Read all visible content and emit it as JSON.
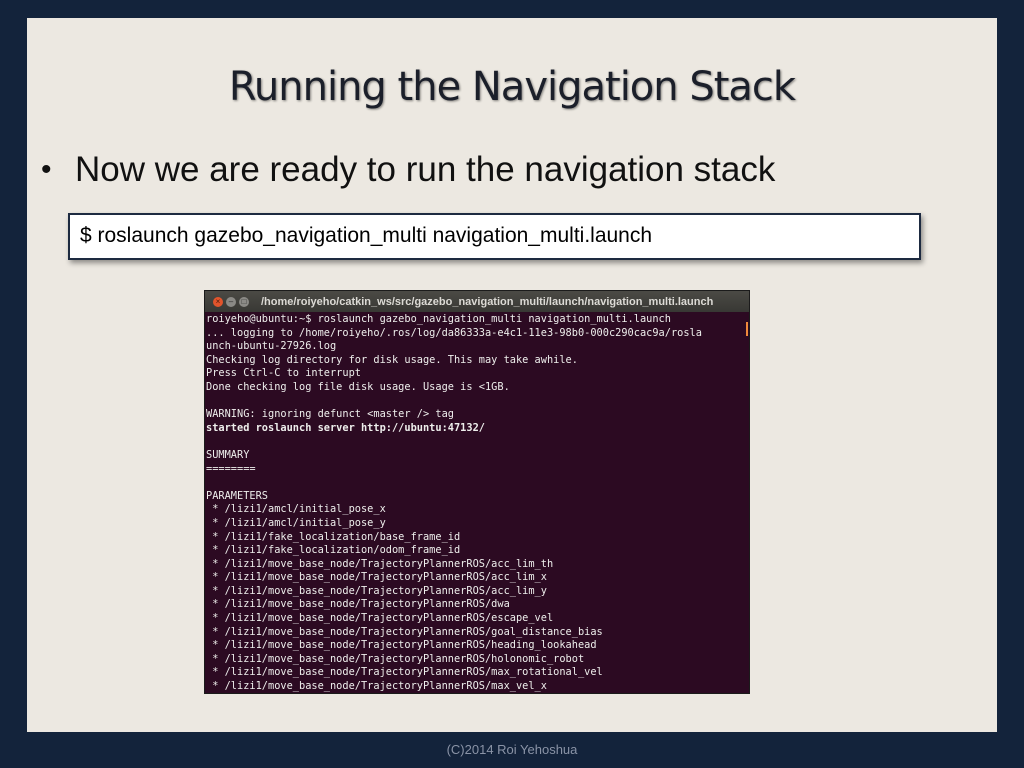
{
  "slide": {
    "title": "Running the Navigation Stack",
    "bullet": "Now we are ready to run the navigation stack",
    "command": "$ roslaunch gazebo_navigation_multi navigation_multi.launch",
    "footer": "(C)2014 Roi Yehoshua"
  },
  "terminal": {
    "title": "/home/roiyeho/catkin_ws/src/gazebo_navigation_multi/launch/navigation_multi.launch",
    "buttons": {
      "close_icon": "×",
      "minimize_icon": "–",
      "maximize_icon": "□"
    },
    "lines": [
      {
        "text": "roiyeho@ubuntu:~$ roslaunch gazebo_navigation_multi navigation_multi.launch",
        "bold": false
      },
      {
        "text": "... logging to /home/roiyeho/.ros/log/da86333a-e4c1-11e3-98b0-000c290cac9a/rosla",
        "bold": false
      },
      {
        "text": "unch-ubuntu-27926.log",
        "bold": false
      },
      {
        "text": "Checking log directory for disk usage. This may take awhile.",
        "bold": false
      },
      {
        "text": "Press Ctrl-C to interrupt",
        "bold": false
      },
      {
        "text": "Done checking log file disk usage. Usage is <1GB.",
        "bold": false
      },
      {
        "text": "",
        "bold": false
      },
      {
        "text": "WARNING: ignoring defunct <master /> tag",
        "bold": false
      },
      {
        "text": "started roslaunch server http://ubuntu:47132/",
        "bold": true
      },
      {
        "text": "",
        "bold": false
      },
      {
        "text": "SUMMARY",
        "bold": false
      },
      {
        "text": "========",
        "bold": false
      },
      {
        "text": "",
        "bold": false
      },
      {
        "text": "PARAMETERS",
        "bold": false
      },
      {
        "text": " * /lizi1/amcl/initial_pose_x",
        "bold": false
      },
      {
        "text": " * /lizi1/amcl/initial_pose_y",
        "bold": false
      },
      {
        "text": " * /lizi1/fake_localization/base_frame_id",
        "bold": false
      },
      {
        "text": " * /lizi1/fake_localization/odom_frame_id",
        "bold": false
      },
      {
        "text": " * /lizi1/move_base_node/TrajectoryPlannerROS/acc_lim_th",
        "bold": false
      },
      {
        "text": " * /lizi1/move_base_node/TrajectoryPlannerROS/acc_lim_x",
        "bold": false
      },
      {
        "text": " * /lizi1/move_base_node/TrajectoryPlannerROS/acc_lim_y",
        "bold": false
      },
      {
        "text": " * /lizi1/move_base_node/TrajectoryPlannerROS/dwa",
        "bold": false
      },
      {
        "text": " * /lizi1/move_base_node/TrajectoryPlannerROS/escape_vel",
        "bold": false
      },
      {
        "text": " * /lizi1/move_base_node/TrajectoryPlannerROS/goal_distance_bias",
        "bold": false
      },
      {
        "text": " * /lizi1/move_base_node/TrajectoryPlannerROS/heading_lookahead",
        "bold": false
      },
      {
        "text": " * /lizi1/move_base_node/TrajectoryPlannerROS/holonomic_robot",
        "bold": false
      },
      {
        "text": " * /lizi1/move_base_node/TrajectoryPlannerROS/max_rotational_vel",
        "bold": false
      },
      {
        "text": " * /lizi1/move_base_node/TrajectoryPlannerROS/max_vel_x",
        "bold": false
      }
    ]
  },
  "colors": {
    "background": "#13233b",
    "slide": "#ece8e1",
    "terminal_bg": "#2c0a22",
    "terminal_text": "#eeeeec",
    "close_button": "#e2542c",
    "cursor": "#f08a3c"
  }
}
